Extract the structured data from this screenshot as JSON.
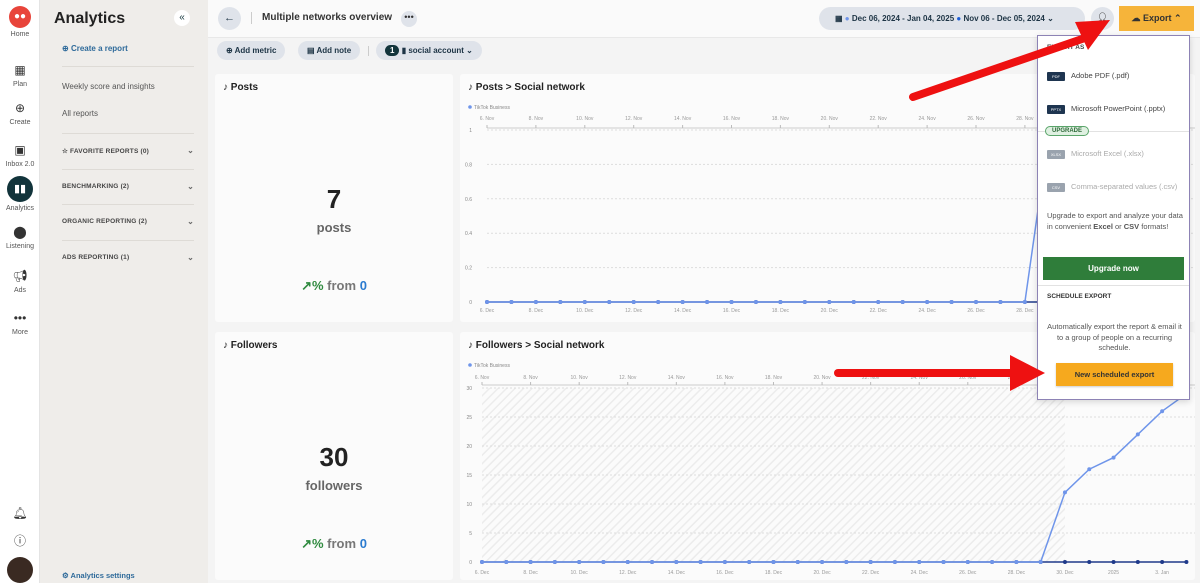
{
  "nav": {
    "items": [
      {
        "label": "Home",
        "icon": "owl-logo-icon"
      },
      {
        "label": "Plan",
        "icon": "calendar-icon"
      },
      {
        "label": "Create",
        "icon": "plus-circle-icon"
      },
      {
        "label": "Inbox 2.0",
        "icon": "inbox-icon"
      },
      {
        "label": "Analytics",
        "icon": "bar-chart-icon",
        "active": true
      },
      {
        "label": "Listening",
        "icon": "pin-icon"
      },
      {
        "label": "Ads",
        "icon": "megaphone-icon"
      },
      {
        "label": "More",
        "icon": "ellipsis-icon"
      }
    ]
  },
  "sidebar": {
    "title": "Analytics",
    "create": "Create a report",
    "links": [
      "Weekly score and insights",
      "All reports"
    ],
    "sections": [
      "FAVORITE REPORTS (0)",
      "BENCHMARKING (2)",
      "ORGANIC REPORTING (2)",
      "ADS REPORTING (1)"
    ],
    "settings": "Analytics settings"
  },
  "header": {
    "title": "Multiple networks overview",
    "date_primary": "Dec 06, 2024 - Jan 04, 2025",
    "date_compare": "Nov 06 - Dec 05, 2024",
    "export": "Export"
  },
  "toolbar": {
    "add_metric": "Add metric",
    "add_note": "Add note",
    "account_count": "1",
    "account_label": "social account"
  },
  "cards": {
    "posts": {
      "title": "Posts",
      "value": "7",
      "unit": "posts",
      "pct": "%",
      "from": "from",
      "from_value": "0"
    },
    "followers": {
      "title": "Followers",
      "value": "30",
      "unit": "followers",
      "pct": "%",
      "from": "from",
      "from_value": "0"
    }
  },
  "colors": {
    "primary": "#6f95ea",
    "compare": "#1f3a8a",
    "accent": "#f5a623",
    "upgrade": "#2f7d3a",
    "arrow": "#ee1111"
  },
  "export_menu": {
    "heading": "EXPORT AS",
    "items": [
      {
        "badge": "PDF",
        "label": "Adobe PDF (.pdf)",
        "disabled": false
      },
      {
        "badge": "PPTX",
        "label": "Microsoft PowerPoint (.pptx)",
        "disabled": false
      },
      {
        "badge": "XLSX",
        "label": "Microsoft Excel (.xlsx)",
        "disabled": true
      },
      {
        "badge": "CSV",
        "label": "Comma-separated values (.csv)",
        "disabled": true
      }
    ],
    "upgrade_badge": "UPGRADE",
    "upgrade_text_1": "Upgrade to export and analyze your data in convenient ",
    "upgrade_excel": "Excel",
    "upgrade_or": " or ",
    "upgrade_csv": "CSV",
    "upgrade_text_2": " formats!",
    "upgrade_button": "Upgrade now",
    "schedule_heading": "SCHEDULE EXPORT",
    "schedule_text": "Automatically export the report & email it to a group of people on a recurring schedule.",
    "schedule_button": "New scheduled export"
  },
  "chart_data": [
    {
      "type": "line",
      "title": "Posts > Social network",
      "legend": [
        "TikTok Business"
      ],
      "x_bottom": [
        "6. Dec",
        "8. Dec",
        "10. Dec",
        "12. Dec",
        "14. Dec",
        "16. Dec",
        "18. Dec",
        "20. Dec",
        "22. Dec",
        "24. Dec",
        "26. Dec",
        "28. Dec"
      ],
      "x_top": [
        "6. Nov",
        "8. Nov",
        "10. Nov",
        "12. Nov",
        "14. Nov",
        "16. Nov",
        "18. Nov",
        "20. Nov",
        "22. Nov",
        "24. Nov",
        "26. Nov",
        "28. Nov"
      ],
      "yticks": [
        "0",
        "0.2",
        "0.4",
        "0.6",
        "0.8",
        "1"
      ],
      "ylim": [
        0,
        1
      ],
      "series": [
        {
          "name": "TikTok Business",
          "values": [
            0,
            0,
            0,
            0,
            0,
            0,
            0,
            0,
            0,
            0,
            0,
            0,
            0,
            0,
            0,
            0,
            0,
            0,
            0,
            0,
            0,
            0,
            0,
            1
          ]
        },
        {
          "values": [
            0,
            0,
            0,
            0,
            0,
            0,
            0,
            0,
            0,
            0,
            0,
            0,
            0,
            0,
            0,
            0,
            0,
            0,
            0,
            0,
            0,
            0,
            0,
            0
          ]
        }
      ]
    },
    {
      "type": "line",
      "title": "Followers > Social network",
      "legend": [
        "TikTok Business"
      ],
      "x_bottom": [
        "6. Dec",
        "8. Dec",
        "10. Dec",
        "12. Dec",
        "14. Dec",
        "16. Dec",
        "18. Dec",
        "20. Dec",
        "22. Dec",
        "24. Dec",
        "26. Dec",
        "28. Dec",
        "30. Dec",
        "2025",
        "3. Jan"
      ],
      "x_top": [
        "6. Nov",
        "8. Nov",
        "10. Nov",
        "12. Nov",
        "14. Nov",
        "16. Nov",
        "18. Nov",
        "20. Nov",
        "22. Nov",
        "24. Nov",
        "26. Nov",
        "28. Nov"
      ],
      "yticks": [
        "0",
        "5",
        "10",
        "15",
        "20",
        "25",
        "30"
      ],
      "ylim": [
        0,
        30
      ],
      "series": [
        {
          "name": "TikTok Business",
          "values": [
            0,
            0,
            0,
            0,
            0,
            0,
            0,
            0,
            0,
            0,
            0,
            0,
            0,
            0,
            0,
            0,
            0,
            0,
            0,
            0,
            0,
            0,
            0,
            0,
            12,
            16,
            18,
            22,
            26,
            29
          ]
        },
        {
          "values": [
            0,
            0,
            0,
            0,
            0,
            0,
            0,
            0,
            0,
            0,
            0,
            0,
            0,
            0,
            0,
            0,
            0,
            0,
            0,
            0,
            0,
            0,
            0,
            0,
            0,
            0,
            0,
            0,
            0,
            0
          ]
        }
      ]
    }
  ]
}
